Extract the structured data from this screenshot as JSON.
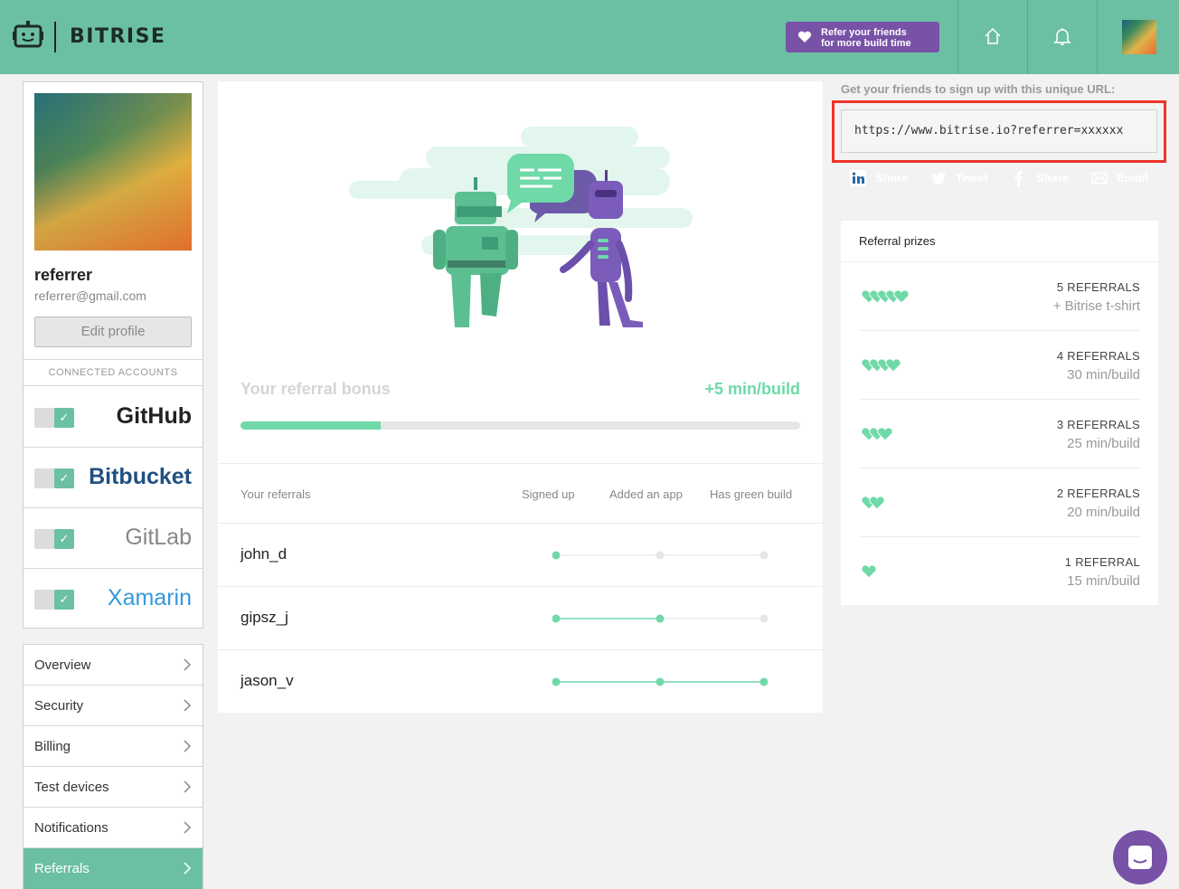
{
  "header": {
    "brand": "BITRISE",
    "refer_button": {
      "line1": "Refer your friends",
      "line2": "for more build time"
    },
    "icons": [
      "home-icon",
      "bell-icon"
    ]
  },
  "profile": {
    "username": "referrer",
    "email": "referrer@gmail.com",
    "edit_label": "Edit profile",
    "connected_label": "CONNECTED ACCOUNTS",
    "accounts": [
      {
        "name": "GitHub",
        "color": "#222222",
        "connected": true
      },
      {
        "name": "Bitbucket",
        "color": "#205081",
        "connected": true
      },
      {
        "name": "GitLab",
        "color": "#888888",
        "connected": true
      },
      {
        "name": "Xamarin",
        "color": "#3498db",
        "connected": true
      }
    ]
  },
  "nav": {
    "items": [
      {
        "label": "Overview",
        "active": false
      },
      {
        "label": "Security",
        "active": false
      },
      {
        "label": "Billing",
        "active": false
      },
      {
        "label": "Test devices",
        "active": false
      },
      {
        "label": "Notifications",
        "active": false
      },
      {
        "label": "Referrals",
        "active": true
      }
    ]
  },
  "referral": {
    "bonus_label": "Your referral bonus",
    "bonus_value": "+5 min/build",
    "progress_fraction": 0.25,
    "table": {
      "headers": [
        "Your referrals",
        "Signed up",
        "Added an app",
        "Has green build"
      ],
      "rows": [
        {
          "name": "john_d",
          "steps": [
            true,
            false,
            false
          ]
        },
        {
          "name": "gipsz_j",
          "steps": [
            true,
            true,
            false
          ]
        },
        {
          "name": "jason_v",
          "steps": [
            true,
            true,
            true
          ]
        }
      ]
    }
  },
  "share": {
    "url_label": "Get your friends to sign up with this unique URL:",
    "url": "https://www.bitrise.io?referrer=xxxxxx",
    "buttons": [
      {
        "label": "Share",
        "icon": "linkedin-icon",
        "color": "#2b6aa8"
      },
      {
        "label": "Tweet",
        "icon": "twitter-icon",
        "color": "#4b8dc4"
      },
      {
        "label": "Share",
        "icon": "facebook-icon",
        "color": "#74c3e3"
      },
      {
        "label": "Email",
        "icon": "email-icon",
        "color": "#e58888"
      }
    ]
  },
  "prizes": {
    "title": "Referral prizes",
    "items": [
      {
        "count": "5 REFERRALS",
        "reward": "+ Bitrise t-shirt",
        "hearts": 5
      },
      {
        "count": "4 REFERRALS",
        "reward": "30 min/build",
        "hearts": 4
      },
      {
        "count": "3 REFERRALS",
        "reward": "25 min/build",
        "hearts": 3
      },
      {
        "count": "2 REFERRALS",
        "reward": "20 min/build",
        "hearts": 2
      },
      {
        "count": "1 REFERRAL",
        "reward": "15 min/build",
        "hearts": 1
      }
    ]
  },
  "colors": {
    "accent": "#6cc0a2",
    "purple": "#7752a7",
    "progress": "#6fd9a8",
    "highlight": "#ee3328"
  }
}
